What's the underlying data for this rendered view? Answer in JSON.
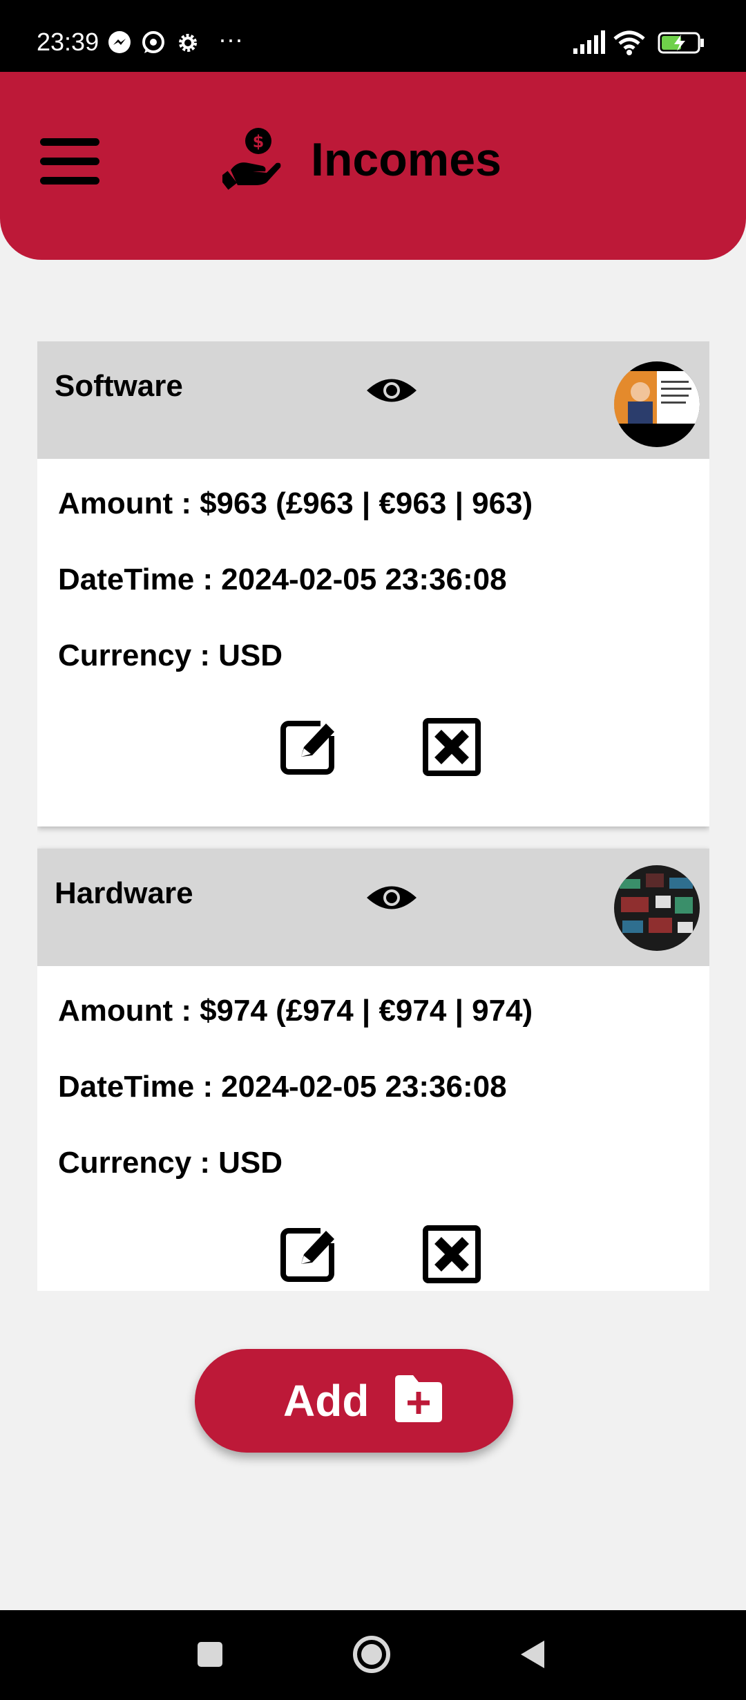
{
  "status_bar": {
    "time": "23:39",
    "more": "···"
  },
  "header": {
    "title": "Incomes"
  },
  "incomes": [
    {
      "name": "Software",
      "amount_label": "Amount :",
      "amount": "$963 (£963 | €963 | 963)",
      "datetime_label": "DateTime :",
      "datetime": "2024-02-05 23:36:08",
      "currency_label": "Currency :",
      "currency": "USD"
    },
    {
      "name": "Hardware",
      "amount_label": "Amount :",
      "amount": "$974 (£974 | €974 | 974)",
      "datetime_label": "DateTime :",
      "datetime": "2024-02-05 23:36:08",
      "currency_label": "Currency :",
      "currency": "USD"
    }
  ],
  "add_button": {
    "label": "Add"
  },
  "colors": {
    "accent": "#bd1938",
    "card_header": "#d6d6d6",
    "background": "#f1f1f1"
  },
  "icons": [
    "messenger-icon",
    "whatsapp-icon",
    "settings-gear-icon",
    "signal-icon",
    "wifi-icon",
    "battery-icon",
    "menu-icon",
    "hand-money-icon",
    "eye-icon",
    "edit-icon",
    "delete-icon",
    "add-folder-icon",
    "nav-recents-icon",
    "nav-home-icon",
    "nav-back-icon"
  ]
}
